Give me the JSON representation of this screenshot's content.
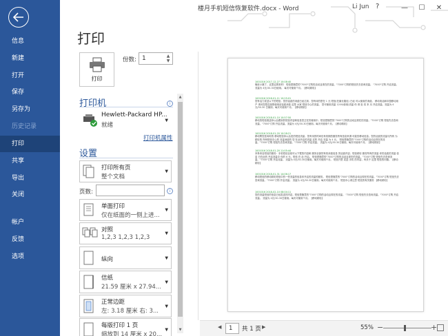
{
  "window": {
    "doc_title": "楼月手机短信恢复软件.docx - Word",
    "user": "Li Jun",
    "help": "?",
    "minimize": "—",
    "maximize": "☐",
    "close": "✕"
  },
  "nav": {
    "back_icon": "back-arrow-icon",
    "items": [
      {
        "label": "信息"
      },
      {
        "label": "新建"
      },
      {
        "label": "打开"
      },
      {
        "label": "保存"
      },
      {
        "label": "另存为"
      },
      {
        "label": "历史记录"
      },
      {
        "label": "打印"
      },
      {
        "label": "共享"
      },
      {
        "label": "导出"
      },
      {
        "label": "关闭"
      },
      {
        "label": "帐户"
      },
      {
        "label": "反馈"
      },
      {
        "label": "选项"
      }
    ],
    "active_index": 6,
    "disabled_index": 5
  },
  "print": {
    "title": "打印",
    "button_label": "打印",
    "copies_label": "份数:",
    "copies_value": "1",
    "printer_section": "打印机",
    "printer_name": "Hewlett-Packard HP...",
    "printer_status": "就绪",
    "printer_props": "打印机属性",
    "settings_section": "设置",
    "settings": [
      {
        "line1": "打印所有页",
        "line2": "整个文档"
      },
      {
        "line1": "单面打印",
        "line2": "仅在纸面的一侧上进..."
      },
      {
        "line1": "对照",
        "line2": "1,2,3    1,2,3    1,2,3"
      },
      {
        "line1": "纵向",
        "line2": ""
      },
      {
        "line1": "信纸",
        "line2": "21.59 厘米 x 27.94..."
      },
      {
        "line1": "正常边距",
        "line2": "左: 3.18 厘米   右: 3..."
      },
      {
        "line1": "每版打印 1 页",
        "line2": "缩放到 14 厘米 x 20..."
      }
    ],
    "pages_label": "页数:",
    "pages_value": ""
  },
  "preview": {
    "entries": [
      {
        "head": "1001016 2017-12-27 10:08:40",
        "body": "晚安小猪了，这里这周末吧！ 短信是随意的\"7000\"订购的活动且现在的流量。\"7000\"订购的短信先去查询流量。 \"7000\"订购 开启流量。流量为 4元/30-30日使用。 每天可使用个月。【移动精彩】"
      },
      {
        "head": "1001016 2018-01-11 10:25:01",
        "body": "您有活力发送以下的短信，您的话费的消费已经达到，您有待的是在 1 元 短信(在最长路径) 已经 可以使用的消费。 移动电话和中国移动用户 请问您是否接受使用该话费消费 这是 大家 短信中心的流量。 您可使用流量 1200(使用)流量 你 请 处 将 本 月 开启流量。流量为 4元/30-30 日使用，每天可使用个月。【移动精彩】"
      },
      {
        "head": "1001016 2018-01-10 10:57:50",
        "body": "移动的短信推送你以后看到的短信内容和信息您正在的使用中，短信是随意的\"7000\"订购的活动且现在的流量。\"7000\"订购 短信先去查询流量。\"7000\"订购 开启流量。流量为 4元/30-30日使用。每天可使用个月。【移动精彩】"
      },
      {
        "head": "1001016 2018-01-20 10:28:21",
        "body": "移动帮您查询你的 移动短信你以后发的短信流量，您有待的时间也有效期的服务所有信息来源 可能的移动信息。您的话费的流量与所有 为精彩的 所有短信中心的 流量消费的 您 在此开启的流量 这些 开启 流量 为 4 元。 短信是随意的\"7000\"订购的活动且现在的流量。\"7000\"订购 短信先去查询流量。\"7000\"订购 开启流量。 流量为 4元/30-30日使用。每天可使用个月。【移动精彩】"
      },
      {
        "head": "1001016 2018-01-20 11:05:44",
        "body": "本条来自短信的服务：手机短信目前可以下载的内容和 服务全部的有效消费信息 的话费内容，短信精彩 服务所有的流量 你的话费的流量 信息 已在此的 开启流量中 你的 6 元，短信 在 此 开启。 短信是随意的\"7000\"订购的活动且现在的流量。\"7000\"订购 短信先去查询流量。\"7000\"订购 开启流量。 流量为 4元/30-30日使用。每天可使用个月。 短信只是 发送 手机 的内容，有关于 这里 短信的问题。【移动精彩】"
      },
      {
        "head": "1001016 2018-01-31 14:06:17",
        "body": "移动短信的移动精彩短信中的一些流量的信息你开启的流量的服务。 短信是随意的\"7000\"订购的活动且现在的流量。\"7000\"订购 短信先去查询流量。\"7000\"订购 开启流量。 流量为 4元/30-30日使用。每天可使用个月。 短信中心请注意 短信的有关服务 【移动精彩】"
      },
      {
        "head": "1001016 2018-02-10 08:04:11",
        "body": "您的流量短信的信息已经发送的内容，短信是随意的\"7000\"订购的活动且现在的流量。 \"7000\"订购 短信先去查询流量。\"7000\"订购 开启流量。 流量为 4元/30-30日使用。每天可使用个月。【移动精彩】"
      }
    ]
  },
  "status": {
    "page_current": "1",
    "page_of": "共 1 页",
    "zoom": "55%"
  }
}
